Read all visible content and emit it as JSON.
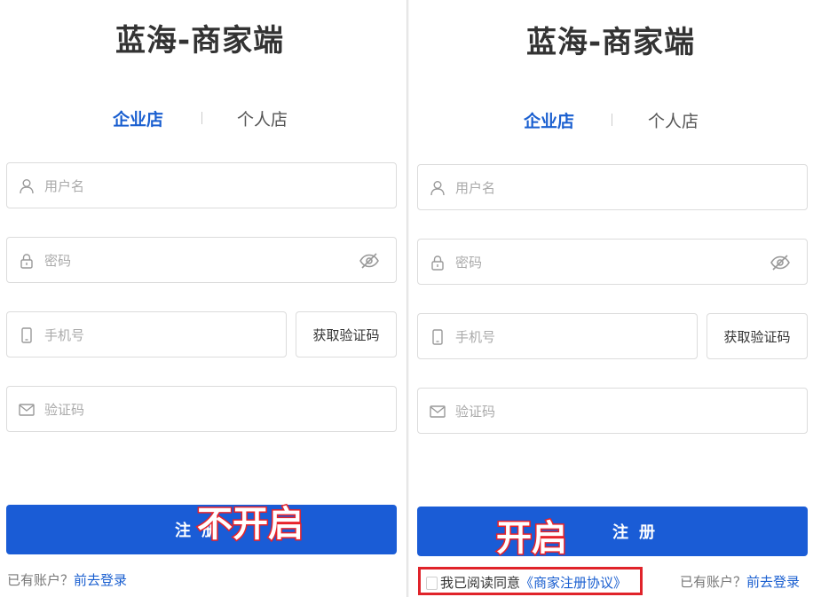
{
  "left": {
    "title": "蓝海-商家端",
    "tabs": [
      "企业店",
      "个人店"
    ],
    "username_placeholder": "用户名",
    "password_placeholder": "密码",
    "phone_placeholder": "手机号",
    "get_code_label": "获取验证码",
    "code_placeholder": "验证码",
    "submit_label": "注册",
    "overlay": "不开启",
    "login_prompt": "已有账户？",
    "login_link": "前去登录"
  },
  "right": {
    "title": "蓝海-商家端",
    "tabs": [
      "企业店",
      "个人店"
    ],
    "username_placeholder": "用户名",
    "password_placeholder": "密码",
    "phone_placeholder": "手机号",
    "get_code_label": "获取验证码",
    "code_placeholder": "验证码",
    "submit_label": "注册",
    "overlay": "开启",
    "agree_text": "我已阅读同意",
    "agree_link": "《商家注册协议》",
    "login_prompt": "已有账户？",
    "login_link": "前去登录"
  },
  "colors": {
    "primary": "#1a5cd6",
    "link": "#1a5fd0",
    "highlight_red": "#e0232a"
  },
  "icons": [
    "user-icon",
    "lock-icon",
    "eye-slash-icon",
    "phone-icon",
    "mail-icon"
  ]
}
